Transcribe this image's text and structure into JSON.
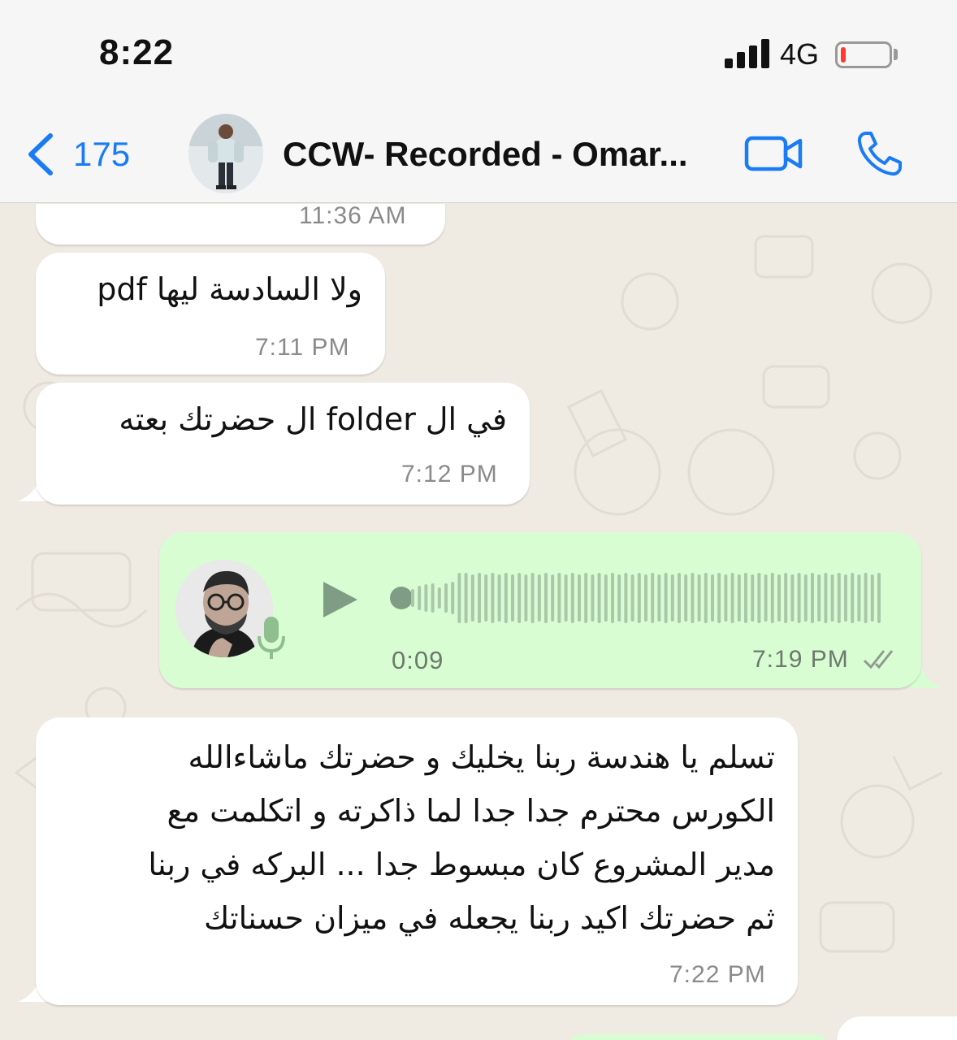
{
  "status_bar": {
    "time": "8:22",
    "network": "4G",
    "battery_level": 0.08,
    "battery_color": "#ff3b30"
  },
  "nav": {
    "back_count": "175",
    "back_icon": "chevron-left-icon",
    "title": "CCW- Recorded - Omar...",
    "video_icon": "video-camera-icon",
    "call_icon": "phone-icon",
    "accent_color": "#1a7cf5"
  },
  "messages": [
    {
      "direction": "incoming",
      "text": "",
      "time": "11:36 AM"
    },
    {
      "direction": "incoming",
      "text": "ولا السادسة ليها pdf",
      "time": "7:11 PM"
    },
    {
      "direction": "incoming",
      "text": "في ال folder ال حضرتك بعته",
      "time": "7:12 PM"
    },
    {
      "direction": "outgoing",
      "type": "voice",
      "duration": "0:09",
      "time": "7:19 PM",
      "status": "read",
      "playback_progress": 0
    },
    {
      "direction": "incoming",
      "lines": [
        "تسلم يا هندسة ربنا يخليك و حضرتك ماشاءالله",
        "الكورس محترم جدا جدا لما ذاكرته و اتكلمت مع",
        "مدير المشروع كان مبسوط جدا ...  البركه في ربنا",
        "ثم حضرتك اكيد ربنا يجعله في ميزان حسناتك"
      ],
      "time": "7:22 PM"
    }
  ],
  "colors": {
    "incoming_bubble": "#ffffff",
    "outgoing_bubble": "#d9fdd3",
    "chat_background": "#efeae2"
  }
}
